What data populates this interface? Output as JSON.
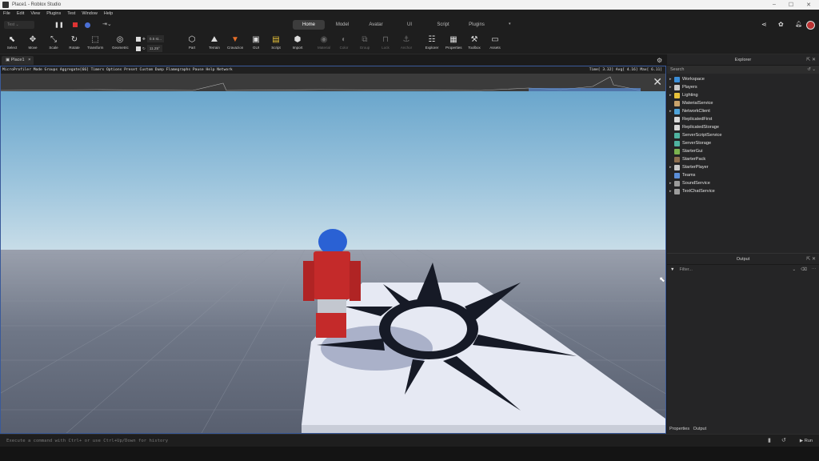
{
  "titlebar": {
    "title": "Place1 - Roblox Studio"
  },
  "menu": [
    "File",
    "Edit",
    "View",
    "Plugins",
    "Test",
    "Window",
    "Help"
  ],
  "ribbon_tabs": [
    "Home",
    "Model",
    "Avatar",
    "UI",
    "Script",
    "Plugins"
  ],
  "active_tab": "Home",
  "play_mode": "Test",
  "toolbar": {
    "select": "Select",
    "move": "Move",
    "scale": "Scale",
    "rotate": "Rotate",
    "transform": "Transform",
    "geometric": "Geometric",
    "move_inc": "0.5 st...",
    "rot_inc": "11.25°",
    "part": "Part",
    "terrain": "Terrain",
    "cravazion": "Cravazion",
    "gui": "GUI",
    "script": "Script",
    "import": "Import",
    "material": "Material",
    "color": "Color",
    "group": "Group",
    "lock": "Lock",
    "anchor": "Anchor",
    "explorer": "Explorer",
    "properties": "Properties",
    "toolbox": "Toolbox",
    "assets": "Assets"
  },
  "document_tab": "Place1",
  "microprofiler": {
    "menu": "MicroProfiler  Mode Groups Aggregate[66] Timers Options Preset Custom Dump Flamegraphs Pause Help Network",
    "stats": "Time[  3.32] Avg[  4.16] Max[  6.11]"
  },
  "explorer": {
    "title": "Explorer",
    "search_placeholder": "Search",
    "items": [
      {
        "label": "Workspace",
        "color": "#3b8ed8",
        "expand": true
      },
      {
        "label": "Players",
        "color": "#c9c9c9",
        "expand": true
      },
      {
        "label": "Lighting",
        "color": "#e8c23a",
        "expand": true
      },
      {
        "label": "MaterialService",
        "color": "#c9a36b",
        "expand": false
      },
      {
        "label": "NetworkClient",
        "color": "#4fa3d9",
        "expand": true
      },
      {
        "label": "ReplicatedFirst",
        "color": "#d8d8d8",
        "expand": false
      },
      {
        "label": "ReplicatedStorage",
        "color": "#d8d8d8",
        "expand": false
      },
      {
        "label": "ServerScriptService",
        "color": "#4fb3a0",
        "expand": false
      },
      {
        "label": "ServerStorage",
        "color": "#4fb3a0",
        "expand": false
      },
      {
        "label": "StarterGui",
        "color": "#7bb34f",
        "expand": false
      },
      {
        "label": "StarterPack",
        "color": "#8d6e4f",
        "expand": false
      },
      {
        "label": "StarterPlayer",
        "color": "#c9c9c9",
        "expand": true
      },
      {
        "label": "Teams",
        "color": "#5b8fd9",
        "expand": false
      },
      {
        "label": "SoundService",
        "color": "#9c9c9c",
        "expand": true
      },
      {
        "label": "TextChatService",
        "color": "#9c9c9c",
        "expand": true
      }
    ]
  },
  "output": {
    "title": "Output",
    "filter_placeholder": "Filter..."
  },
  "bottom_tabs": [
    "Properties",
    "Output"
  ],
  "command_bar": {
    "placeholder": "Execute a command with Ctrl+ or use Ctrl+Up/Down for history",
    "run": "Run"
  }
}
